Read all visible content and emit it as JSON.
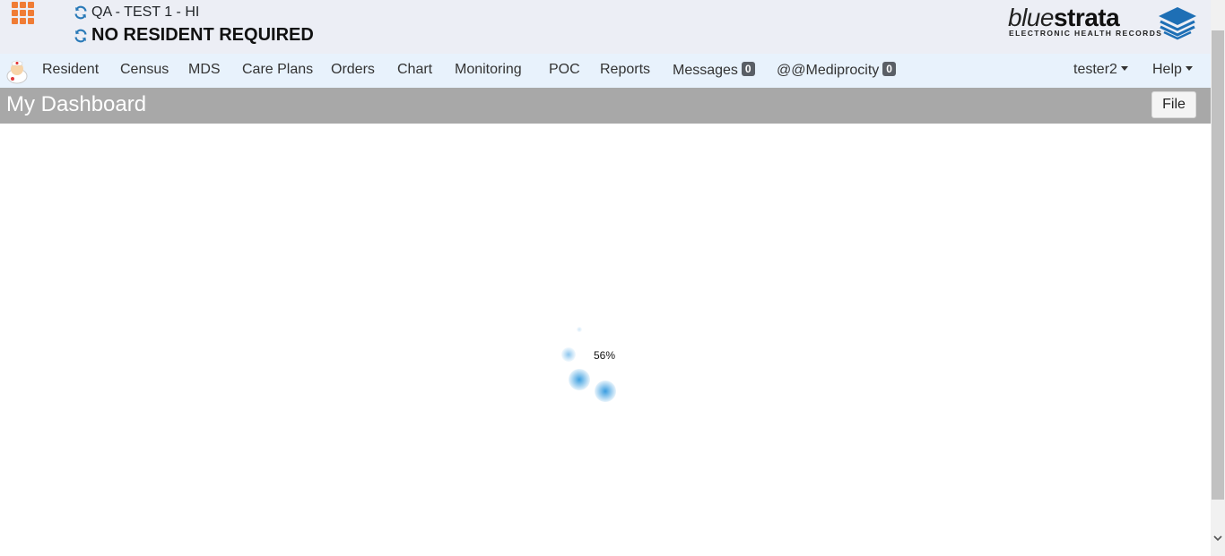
{
  "header": {
    "facility": "QA - TEST 1 - HI",
    "resident": "NO RESIDENT REQUIRED",
    "brand": {
      "word_light": "blue",
      "word_bold": "strata",
      "tagline": "ELECTRONIC HEALTH RECORDS"
    },
    "icons": {
      "apps": "apps-grid-icon",
      "refresh": "refresh-icon",
      "brand": "layered-stack-logo"
    },
    "colors": {
      "apps_accent": "#f07c35",
      "refresh": "#2a7ab8",
      "brand_blue": "#1e6fb5"
    }
  },
  "nav": {
    "items": [
      {
        "label": "Resident"
      },
      {
        "label": "Census"
      },
      {
        "label": "MDS"
      },
      {
        "label": "Care Plans"
      },
      {
        "label": "Orders"
      },
      {
        "label": "Chart"
      },
      {
        "label": "Monitoring"
      },
      {
        "label": "POC"
      },
      {
        "label": "Reports"
      },
      {
        "label": "Messages",
        "badge": "0"
      },
      {
        "label": "@@Mediprocity",
        "badge": "0"
      }
    ],
    "user_menu": "tester2",
    "help_menu": "Help"
  },
  "dashboard": {
    "title": "My Dashboard",
    "file_button": "File"
  },
  "loading": {
    "progress": "56%",
    "progress_value": 56
  }
}
